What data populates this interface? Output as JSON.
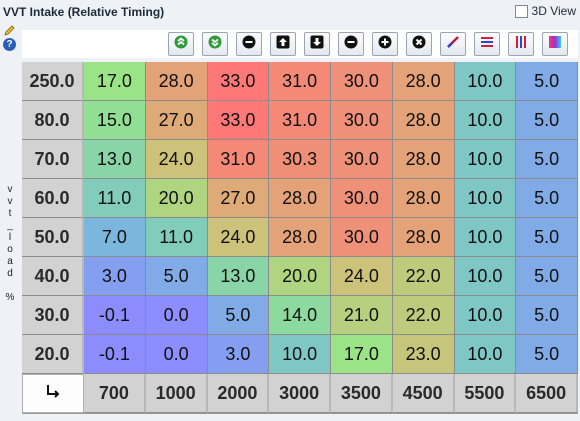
{
  "window": {
    "title": "VVT Intake (Relative Timing)"
  },
  "view3d": {
    "label": "3D View",
    "checked": false
  },
  "side": {
    "axis_label": [
      "v",
      "v",
      "t",
      "_",
      "l",
      "o",
      "a",
      "d",
      "",
      "%"
    ]
  },
  "toolbar": {
    "buttons": [
      {
        "name": "decrement-icon",
        "color": "#2e9a3a"
      },
      {
        "name": "increment-icon",
        "color": "#2e9a3a"
      },
      {
        "name": "minus-icon",
        "color": "#111"
      },
      {
        "name": "shift-up-icon",
        "color": "#111"
      },
      {
        "name": "shift-down-icon",
        "color": "#111"
      },
      {
        "name": "subtract-icon",
        "color": "#111"
      },
      {
        "name": "add-icon",
        "color": "#111"
      },
      {
        "name": "clear-icon",
        "color": "#111"
      },
      {
        "name": "interpolate-icon",
        "color": "#c0174a"
      },
      {
        "name": "horizontal-smooth-icon",
        "color": "#d02040"
      },
      {
        "name": "vertical-smooth-icon",
        "color": "#d02040"
      },
      {
        "name": "color-scale-icon",
        "color": "#9933cc"
      }
    ]
  },
  "table": {
    "y_axis": [
      "250.0",
      "80.0",
      "70.0",
      "60.0",
      "50.0",
      "40.0",
      "30.0",
      "20.0"
    ],
    "x_axis": [
      "700",
      "1000",
      "2000",
      "3000",
      "3500",
      "4500",
      "5500",
      "6500"
    ],
    "rows": [
      [
        "17.0",
        "28.0",
        "33.0",
        "31.0",
        "30.0",
        "28.0",
        "10.0",
        "5.0"
      ],
      [
        "15.0",
        "27.0",
        "33.0",
        "31.0",
        "30.0",
        "28.0",
        "10.0",
        "5.0"
      ],
      [
        "13.0",
        "24.0",
        "31.0",
        "30.3",
        "30.0",
        "28.0",
        "10.0",
        "5.0"
      ],
      [
        "11.0",
        "20.0",
        "27.0",
        "28.0",
        "30.0",
        "28.0",
        "10.0",
        "5.0"
      ],
      [
        "7.0",
        "11.0",
        "24.0",
        "28.0",
        "30.0",
        "28.0",
        "10.0",
        "5.0"
      ],
      [
        "3.0",
        "5.0",
        "13.0",
        "20.0",
        "24.0",
        "22.0",
        "10.0",
        "5.0"
      ],
      [
        "-0.1",
        "0.0",
        "5.0",
        "14.0",
        "21.0",
        "22.0",
        "10.0",
        "5.0"
      ],
      [
        "-0.1",
        "0.0",
        "3.0",
        "10.0",
        "17.0",
        "23.0",
        "10.0",
        "5.0"
      ]
    ],
    "corner_icon": "axis-swap-icon"
  }
}
